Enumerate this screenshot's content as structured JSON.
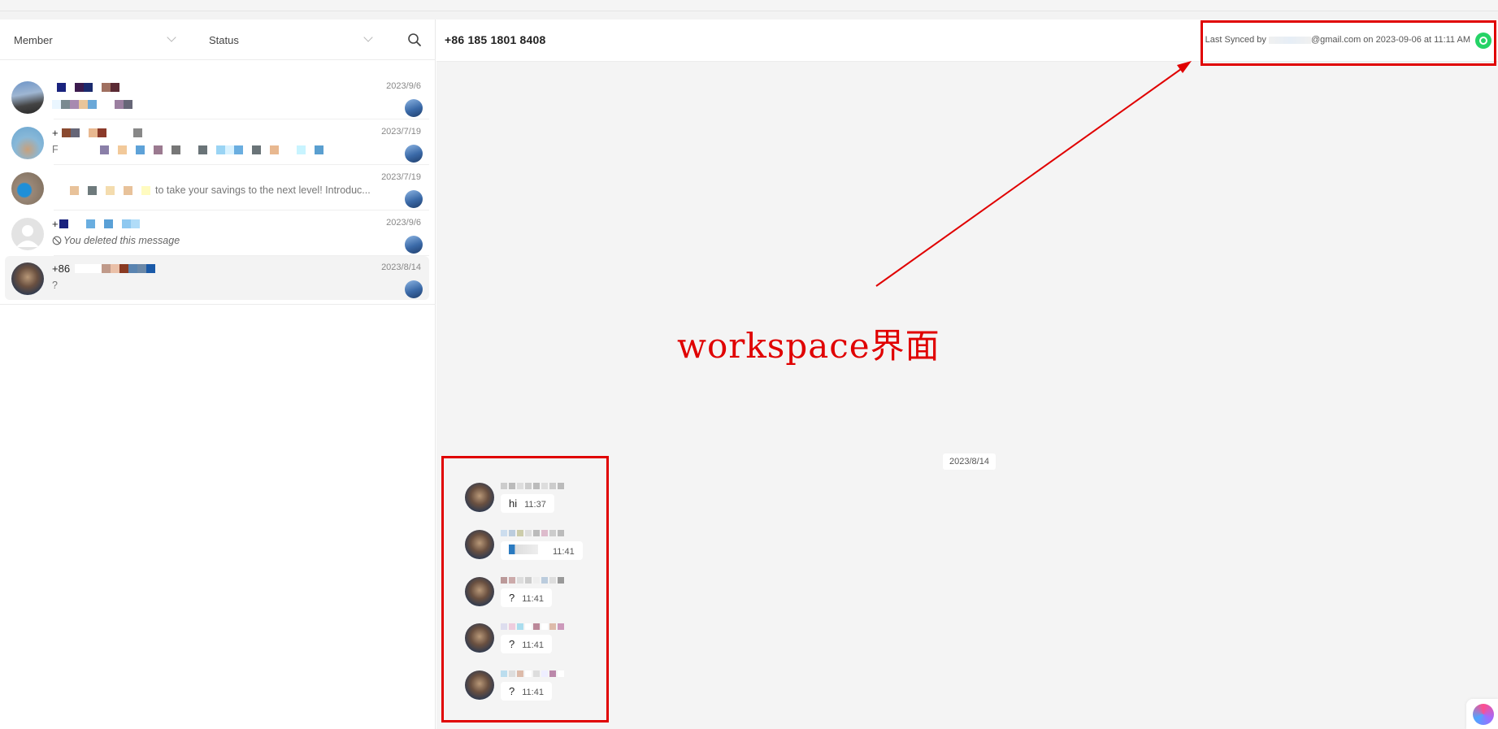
{
  "filters": {
    "member_label": "Member",
    "status_label": "Status"
  },
  "conversations": [
    {
      "name": "",
      "preview": "",
      "date": "2023/9/6",
      "active": false
    },
    {
      "name": "+",
      "preview": "F",
      "date": "2023/7/19",
      "active": false
    },
    {
      "name": "",
      "preview": "to take your savings to the next level! Introduc...",
      "date": "2023/7/19",
      "active": false
    },
    {
      "name": "+",
      "preview": "You deleted this message",
      "date": "2023/9/6",
      "active": false
    },
    {
      "name": "+86",
      "preview": "?",
      "date": "2023/8/14",
      "active": true
    }
  ],
  "chat": {
    "header_phone": "+86 185 1801 8408",
    "synced_prefix": "Last Synced by",
    "synced_suffix": "@gmail.com on 2023-09-06 at 11:11 AM",
    "date_chip": "2023/8/14",
    "messages": [
      {
        "text": "hi",
        "time": "11:37"
      },
      {
        "text": "",
        "time": "11:41"
      },
      {
        "text": "?",
        "time": "11:41"
      },
      {
        "text": "?",
        "time": "11:41"
      },
      {
        "text": "?",
        "time": "11:41"
      }
    ]
  },
  "annotation": {
    "label": "workspace界面",
    "color": "#e00000"
  },
  "colors": {
    "accent_red": "#e00000",
    "whatsapp_green": "#25d366",
    "panel_bg": "#f4f4f4"
  },
  "icons": {
    "search": "search-icon",
    "whatsapp": "whatsapp-icon",
    "deleted": "block-icon"
  }
}
